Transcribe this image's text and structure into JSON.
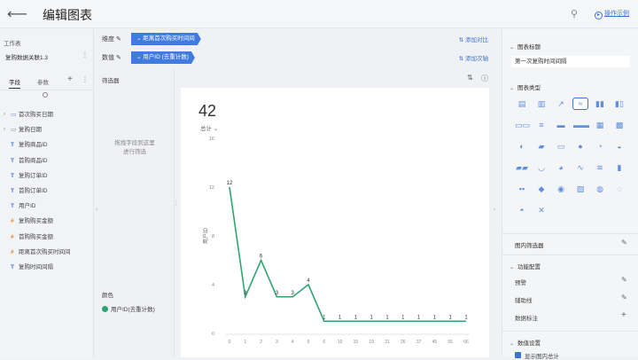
{
  "header": {
    "title": "编辑图表",
    "help_label": "操作示例"
  },
  "left": {
    "worksheet_label": "工作表",
    "dataset_name": "复购数据关联1.3",
    "tabs": [
      "字段",
      "参数"
    ],
    "fields": [
      {
        "type": "date",
        "label": "首次购买日期",
        "expandable": true
      },
      {
        "type": "date",
        "label": "复购日期",
        "expandable": true
      },
      {
        "type": "T",
        "label": "复购商品ID"
      },
      {
        "type": "T",
        "label": "首购商品ID"
      },
      {
        "type": "T",
        "label": "复购订单ID"
      },
      {
        "type": "T",
        "label": "首购订单ID"
      },
      {
        "type": "T",
        "label": "用户ID"
      },
      {
        "type": "#",
        "label": "复购购买金额"
      },
      {
        "type": "#",
        "label": "首购购买金额"
      },
      {
        "type": "#",
        "label": "距离首次购买时间间"
      },
      {
        "type": "T",
        "label": "复购时间间隔"
      }
    ]
  },
  "shelves": {
    "dimension_label": "维度",
    "dimension_pill": "距离首次购买时间间",
    "dimension_add": "添加对比",
    "value_label": "数值",
    "value_pill": "用户ID (去重计数)",
    "value_add": "添加次轴"
  },
  "filter": {
    "title": "筛选器",
    "hint_line1": "拖拽字段到这里",
    "hint_line2": "进行筛选"
  },
  "color": {
    "title": "颜色",
    "legend_item": "用户ID(去重计数)"
  },
  "summary": {
    "total": "42",
    "label": "总计"
  },
  "chart_data": {
    "type": "line",
    "x": [
      "0",
      "1",
      "2",
      "3",
      "4",
      "5",
      "6",
      "10",
      "15",
      "19",
      "21",
      "26",
      "37",
      "45",
      "55",
      "66"
    ],
    "values": [
      12,
      3,
      6,
      3,
      3,
      4,
      1,
      1,
      1,
      1,
      1,
      1,
      1,
      1,
      1,
      1
    ],
    "y_ticks": [
      "0",
      "4",
      "8",
      "12",
      "16"
    ],
    "ylim": [
      0,
      16
    ],
    "ylabel": "用户ID",
    "color": "#2ea473"
  },
  "right": {
    "sections": {
      "chart_title": "图表标题",
      "chart_type": "图表类型",
      "inner_filter": "图内筛选器",
      "feature_config": "功能配置",
      "value_settings": "数值设置"
    },
    "title_value": "第一次复购时间间隔",
    "options": [
      "预警",
      "辅助线",
      "数据标注"
    ],
    "checkbox_label": "显示图内总计"
  }
}
